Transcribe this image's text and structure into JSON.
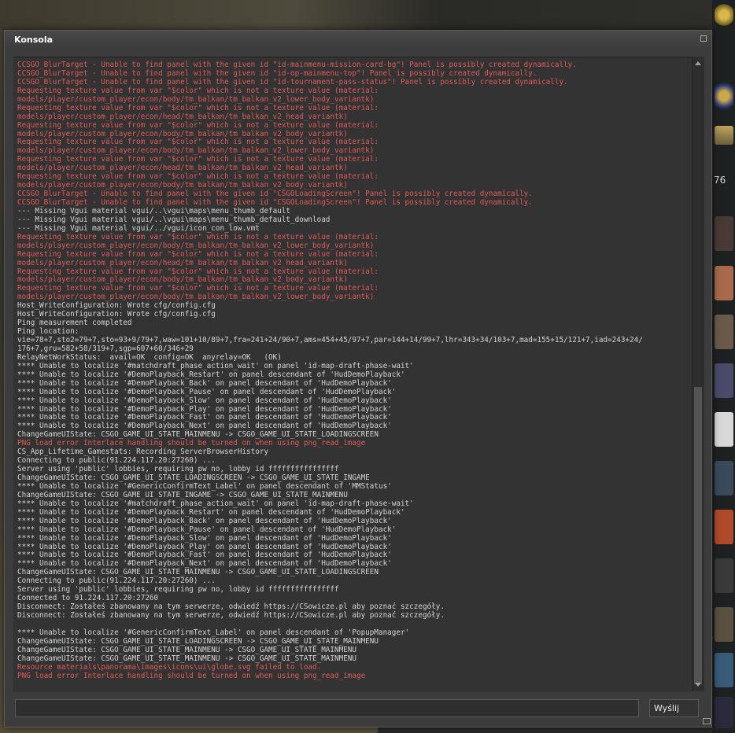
{
  "window": {
    "title": "Konsola"
  },
  "input": {
    "value": "",
    "placeholder": ""
  },
  "send_button": {
    "label": "Wyślij"
  },
  "sidebar_badge": "76",
  "colors": {
    "error": "#e05a5a",
    "normal": "#d6d6d6",
    "background": "#333333"
  },
  "log": [
    {
      "t": "CCSGO_BlurTarget - Unable to find panel with the given id \"id-mainmenu-mission-card-bg\"! Panel is possibly created dynamically.",
      "e": true
    },
    {
      "t": "CCSGO_BlurTarget - Unable to find panel with the given id \"id-op-mainmenu-top\"! Panel is possibly created dynamically.",
      "e": true
    },
    {
      "t": "CCSGO_BlurTarget - Unable to find panel with the given id \"id-tournament-pass-status\"! Panel is possibly created dynamically.",
      "e": true
    },
    {
      "t": "Requesting texture value from var \"$color\" which is not a texture value (material:",
      "e": true
    },
    {
      "t": "models/player/custom_player/econ/body/tm_balkan/tm_balkan_v2_lower_body_variantk)",
      "e": true
    },
    {
      "t": "Requesting texture value from var \"$color\" which is not a texture value (material:",
      "e": true
    },
    {
      "t": "models/player/custom_player/econ/head/tm_balkan/tm_balkan_v2_head_variantk)",
      "e": true
    },
    {
      "t": "Requesting texture value from var \"$color\" which is not a texture value (material:",
      "e": true
    },
    {
      "t": "models/player/custom_player/econ/body/tm_balkan/tm_balkan_v2_body_variantk)",
      "e": true
    },
    {
      "t": "Requesting texture value from var \"$color\" which is not a texture value (material:",
      "e": true
    },
    {
      "t": "models/player/custom_player/econ/body/tm_balkan/tm_balkan_v2_lower_body_variantk)",
      "e": true
    },
    {
      "t": "Requesting texture value from var \"$color\" which is not a texture value (material:",
      "e": true
    },
    {
      "t": "models/player/custom_player/econ/head/tm_balkan/tm_balkan_v2_head_variantk)",
      "e": true
    },
    {
      "t": "Requesting texture value from var \"$color\" which is not a texture value (material:",
      "e": true
    },
    {
      "t": "models/player/custom_player/econ/body/tm_balkan/tm_balkan_v2_body_variantk)",
      "e": true
    },
    {
      "t": "CCSGO_BlurTarget - Unable to find panel with the given id \"CSGOLoadingScreen\"! Panel is possibly created dynamically.",
      "e": true
    },
    {
      "t": "CCSGO_BlurTarget - Unable to find panel with the given id \"CSGOLoadingScreen\"! Panel is possibly created dynamically.",
      "e": true
    },
    {
      "t": "--- Missing Vgui material vgui/..\\vgui\\maps\\menu_thumb_default",
      "e": false
    },
    {
      "t": "--- Missing Vgui material vgui/..\\vgui\\maps\\menu_thumb_default_download",
      "e": false
    },
    {
      "t": "--- Missing Vgui material vgui/../vgui/icon_con_low.vmt",
      "e": false
    },
    {
      "t": "Requesting texture value from var \"$color\" which is not a texture value (material:",
      "e": true
    },
    {
      "t": "models/player/custom_player/econ/body/tm_balkan/tm_balkan_v2_lower_body_variantk)",
      "e": true
    },
    {
      "t": "Requesting texture value from var \"$color\" which is not a texture value (material:",
      "e": true
    },
    {
      "t": "models/player/custom_player/econ/head/tm_balkan/tm_balkan_v2_head_variantk)",
      "e": true
    },
    {
      "t": "Requesting texture value from var \"$color\" which is not a texture value (material:",
      "e": true
    },
    {
      "t": "models/player/custom_player/econ/body/tm_balkan/tm_balkan_v2_body_variantk)",
      "e": true
    },
    {
      "t": "Requesting texture value from var \"$color\" which is not a texture value (material:",
      "e": true
    },
    {
      "t": "models/player/custom_player/econ/body/tm_balkan/tm_balkan_v2_lower_body_variantk)",
      "e": true
    },
    {
      "t": "Host_WriteConfiguration: Wrote cfg/config.cfg",
      "e": false
    },
    {
      "t": "Host_WriteConfiguration: Wrote cfg/config.cfg",
      "e": false
    },
    {
      "t": "Ping measurement completed",
      "e": false
    },
    {
      "t": "Ping location:",
      "e": false
    },
    {
      "t": "vie=78+7,sto2=79+7,sto=93+9/79+7,waw=101+10/89+7,fra=241+24/90+7,ams=454+45/97+7,par=144+14/99+7,lhr=343+34/103+7,mad=155+15/121+7,iad=243+24/",
      "e": false
    },
    {
      "t": "176+7,gru=582+58/319+7,sgp=607+60/346+29",
      "e": false
    },
    {
      "t": "RelayNetWorkStatus:  avail=OK  config=OK  anyrelay=OK   (OK)",
      "e": false
    },
    {
      "t": "**** Unable to localize '#matchdraft_phase_action_wait' on panel 'id-map-draft-phase-wait'",
      "e": false
    },
    {
      "t": "**** Unable to localize '#DemoPlayback_Restart' on panel descendant of 'HudDemoPlayback'",
      "e": false
    },
    {
      "t": "**** Unable to localize '#DemoPlayback_Back' on panel descendant of 'HudDemoPlayback'",
      "e": false
    },
    {
      "t": "**** Unable to localize '#DemoPlayback_Pause' on panel descendant of 'HudDemoPlayback'",
      "e": false
    },
    {
      "t": "**** Unable to localize '#DemoPlayback_Slow' on panel descendant of 'HudDemoPlayback'",
      "e": false
    },
    {
      "t": "**** Unable to localize '#DemoPlayback_Play' on panel descendant of 'HudDemoPlayback'",
      "e": false
    },
    {
      "t": "**** Unable to localize '#DemoPlayback_Fast' on panel descendant of 'HudDemoPlayback'",
      "e": false
    },
    {
      "t": "**** Unable to localize '#DemoPlayback_Next' on panel descendant of 'HudDemoPlayback'",
      "e": false
    },
    {
      "t": "ChangeGameUIState: CSGO_GAME_UI_STATE_MAINMENU -> CSGO_GAME_UI_STATE_LOADINGSCREEN",
      "e": false
    },
    {
      "t": "PNG load error Interlace handling should be turned on when using png_read_image",
      "e": true
    },
    {
      "t": "CS_App_Lifetime_Gamestats: Recording ServerBrowserHistory",
      "e": false
    },
    {
      "t": "Connecting to public(91.224.117.20:27260) ...",
      "e": false
    },
    {
      "t": "Server using 'public' lobbies, requiring pw no, lobby id ffffffffffffffff",
      "e": false
    },
    {
      "t": "ChangeGameUIState: CSGO_GAME_UI_STATE_LOADINGSCREEN -> CSGO_GAME_UI_STATE_INGAME",
      "e": false
    },
    {
      "t": "**** Unable to localize '#GenericConfirmText_Label' on panel descendant of 'MMStatus'",
      "e": false
    },
    {
      "t": "ChangeGameUIState: CSGO_GAME_UI_STATE_INGAME -> CSGO_GAME_UI_STATE_MAINMENU",
      "e": false
    },
    {
      "t": "**** Unable to localize '#matchdraft_phase_action_wait' on panel 'id-map-draft-phase-wait'",
      "e": false
    },
    {
      "t": "**** Unable to localize '#DemoPlayback_Restart' on panel descendant of 'HudDemoPlayback'",
      "e": false
    },
    {
      "t": "**** Unable to localize '#DemoPlayback_Back' on panel descendant of 'HudDemoPlayback'",
      "e": false
    },
    {
      "t": "**** Unable to localize '#DemoPlayback_Pause' on panel descendant of 'HudDemoPlayback'",
      "e": false
    },
    {
      "t": "**** Unable to localize '#DemoPlayback_Slow' on panel descendant of 'HudDemoPlayback'",
      "e": false
    },
    {
      "t": "**** Unable to localize '#DemoPlayback_Play' on panel descendant of 'HudDemoPlayback'",
      "e": false
    },
    {
      "t": "**** Unable to localize '#DemoPlayback_Fast' on panel descendant of 'HudDemoPlayback'",
      "e": false
    },
    {
      "t": "**** Unable to localize '#DemoPlayback_Next' on panel descendant of 'HudDemoPlayback'",
      "e": false
    },
    {
      "t": "ChangeGameUIState: CSGO_GAME_UI_STATE_MAINMENU -> CSGO_GAME_UI_STATE_LOADINGSCREEN",
      "e": false
    },
    {
      "t": "Connecting to public(91.224.117.20:27260) ...",
      "e": false
    },
    {
      "t": "Server using 'public' lobbies, requiring pw no, lobby id ffffffffffffffff",
      "e": false
    },
    {
      "t": "Connected to 91.224.117.20:27260",
      "e": false
    },
    {
      "t": "Disconnect: Zostałeś zbanowany na tym serwerze, odwiedź https://CSowicze.pl aby poznać szczegóły.",
      "e": false
    },
    {
      "t": "Disconnect: Zostałeś zbanowany na tym serwerze, odwiedź https://CSowicze.pl aby poznać szczegóły.",
      "e": false
    },
    {
      "t": "",
      "e": false
    },
    {
      "t": "**** Unable to localize '#GenericConfirmText_Label' on panel descendant of 'PopupManager'",
      "e": false
    },
    {
      "t": "ChangeGameUIState: CSGO_GAME_UI_STATE_LOADINGSCREEN -> CSGO_GAME_UI_STATE_MAINMENU",
      "e": false
    },
    {
      "t": "ChangeGameUIState: CSGO_GAME_UI_STATE_MAINMENU -> CSGO_GAME_UI_STATE_MAINMENU",
      "e": false
    },
    {
      "t": "ChangeGameUIState: CSGO_GAME_UI_STATE_MAINMENU -> CSGO_GAME_UI_STATE_MAINMENU",
      "e": false
    },
    {
      "t": "Resource materials\\panorama\\images\\icons\\ui\\globe.svg failed to load.",
      "e": true
    },
    {
      "t": "PNG load error Interlace handling should be turned on when using png_read_image",
      "e": true
    }
  ]
}
